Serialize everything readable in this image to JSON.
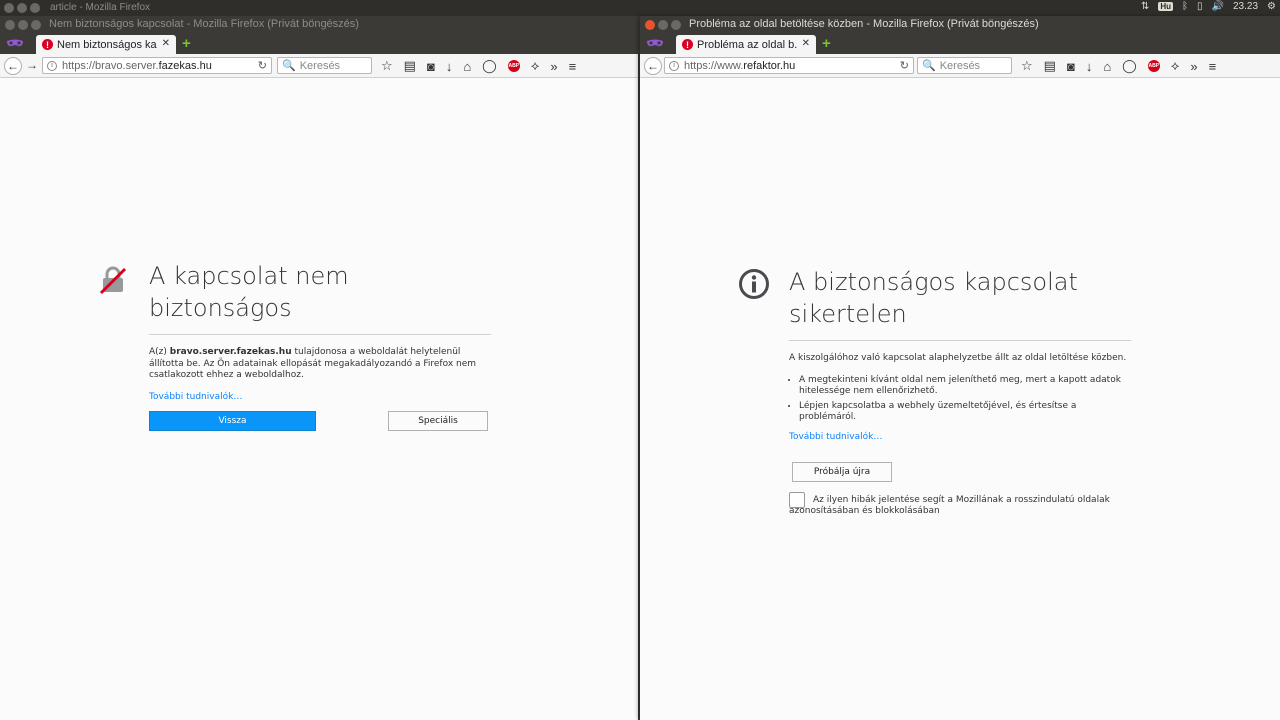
{
  "top_panel": {
    "bg_window_title": "article - Mozilla Firefox",
    "keyboard_layout": "Hu",
    "clock": "23.23"
  },
  "left_window": {
    "title": "Nem biztonságos kapcsolat - Mozilla Firefox (Privát böngészés)",
    "tab_label": "Nem biztonságos ka...",
    "url_prefix": "https://bravo.server.",
    "url_host": "fazekas.hu",
    "search_placeholder": "Keresés",
    "error_title": "A kapcsolat nem biztonságos",
    "desc_prefix": "A(z) ",
    "desc_host": "bravo.server.fazekas.hu",
    "desc_rest": " tulajdonosa a weboldalát helytelenül állította be. Az Ön adatainak ellopását megakadályozandó a Firefox nem csatlakozott ehhez a weboldalhoz.",
    "learn_more": "További tudnivalók…",
    "back_button": "Vissza",
    "advanced_button": "Speciális"
  },
  "right_window": {
    "title": "Probléma az oldal betöltése közben - Mozilla Firefox (Privát böngészés)",
    "tab_label": "Probléma az oldal b...",
    "url_prefix": "https://www.",
    "url_host": "refaktor.hu",
    "search_placeholder": "Keresés",
    "error_title": "A biztonságos kapcsolat sikertelen",
    "intro": "A kiszolgálóhoz való kapcsolat alaphelyzetbe állt az oldal letöltése közben.",
    "bullets": [
      "A megtekinteni kívánt oldal nem jeleníthető meg, mert a kapott adatok hitelessége nem ellenőrizhető.",
      "Lépjen kapcsolatba a webhely üzemeltetőjével, és értesítse a problémáról."
    ],
    "learn_more": "További tudnivalók…",
    "retry_button": "Próbálja újra",
    "report_label": "Az ilyen hibák jelentése segít a Mozillának a rosszindulatú oldalak azonosításában és blokkolásában"
  }
}
